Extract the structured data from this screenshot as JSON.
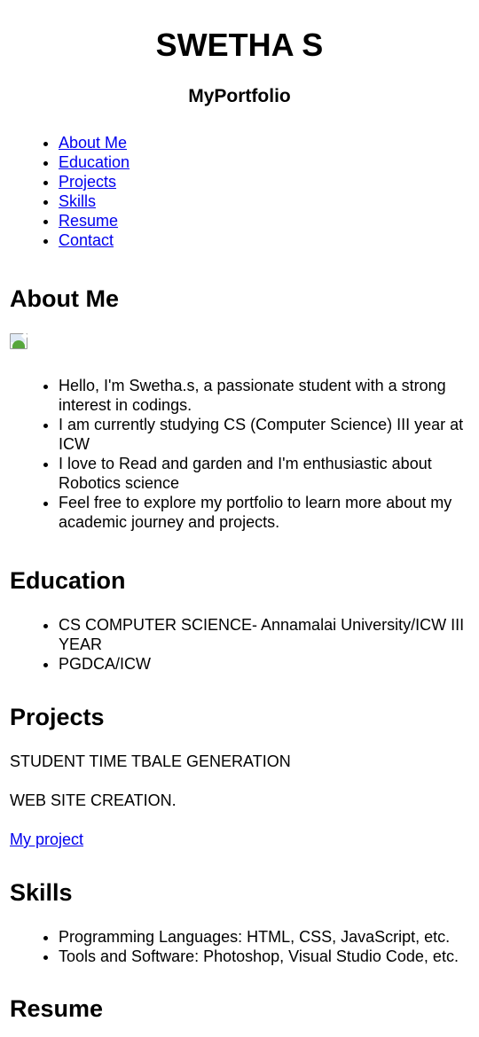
{
  "header": {
    "title": "SWETHA S",
    "subtitle": "MyPortfolio"
  },
  "nav": {
    "items": [
      "About Me",
      "Education",
      "Projects",
      "Skills",
      "Resume",
      "Contact"
    ]
  },
  "about": {
    "heading": "About Me",
    "image_icon": "broken-image-icon",
    "items": [
      "Hello, I'm Swetha.s, a passionate student with a strong interest in codings.",
      "I am currently studying CS (Computer Science) III year at ICW",
      "I love to Read and garden and I'm enthusiastic about Robotics science",
      "Feel free to explore my portfolio to learn more about my academic journey and projects."
    ]
  },
  "education": {
    "heading": "Education",
    "items": [
      "CS COMPUTER SCIENCE- Annamalai University/ICW III YEAR",
      "PGDCA/ICW"
    ]
  },
  "projects": {
    "heading": "Projects",
    "items": [
      "STUDENT TIME TBALE GENERATION",
      "WEB SITE CREATION."
    ],
    "link": "My project"
  },
  "skills": {
    "heading": "Skills",
    "items": [
      "Programming Languages: HTML, CSS, JavaScript, etc.",
      "Tools and Software: Photoshop, Visual Studio Code, etc."
    ]
  },
  "resume": {
    "heading": "Resume"
  },
  "colors": {
    "link": "#0000ee",
    "text": "#000000",
    "background": "#ffffff"
  }
}
